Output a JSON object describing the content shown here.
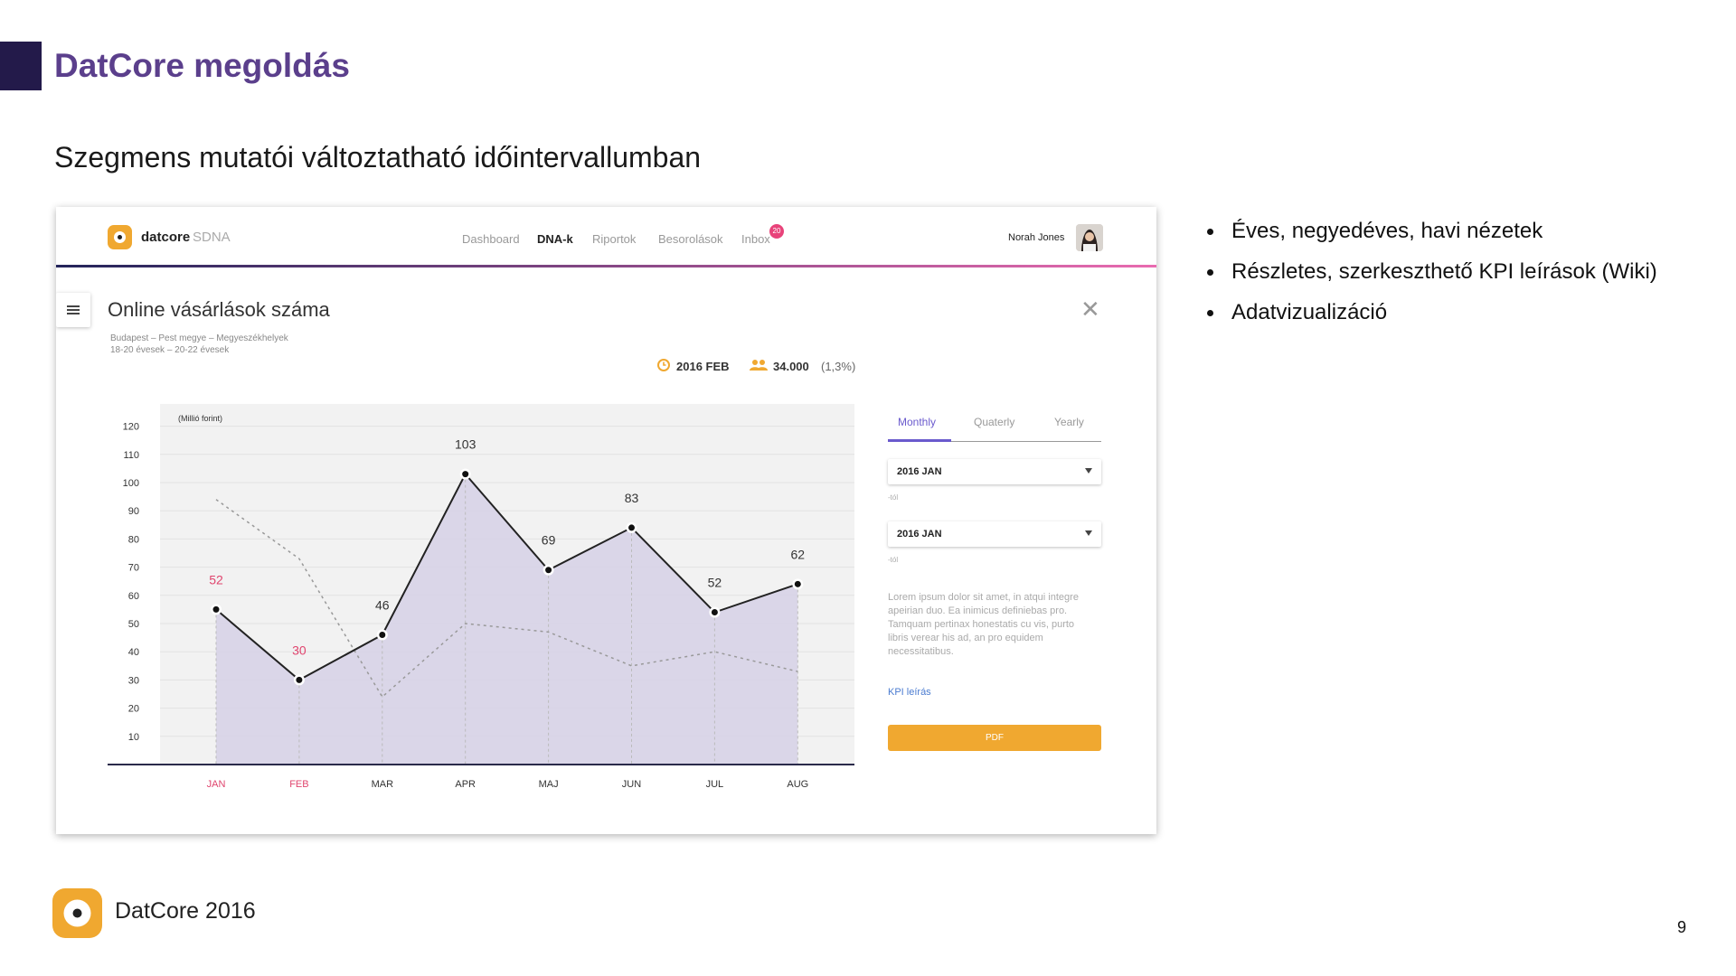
{
  "slide": {
    "title": "DatCore megoldás",
    "subtitle": "Szegmens mutatói változtatható időintervallumban",
    "bullets": [
      "Éves, negyedéves, havi nézetek",
      "Részletes, szerkeszthető KPI leírások (Wiki)",
      "Adatvizualizáció"
    ],
    "footer_text": "DatCore 2016",
    "page_number": "9",
    "colors": {
      "title": "#5b3f8c",
      "accent_block": "#231a4a",
      "logo": "#f0a830",
      "bullet": "#111111"
    }
  },
  "app": {
    "brand_name": "datcore",
    "brand_suffix": "SDNA",
    "nav": [
      "Dashboard",
      "DNA-k",
      "Riportok",
      "Besorolások",
      "Inbox"
    ],
    "nav_active": "DNA-k",
    "inbox_badge": "20",
    "user_name": "Norah Jones",
    "card_title": "Online vásárlások száma",
    "meta_lines": [
      "Budapest – Pest megye – Megyeszékhelyek",
      "18-20 évesek – 20-22 évesek"
    ],
    "stat_date": "2016 FEB",
    "stat_count": "34.000",
    "stat_percent": "(1,3%)",
    "tabs": [
      "Monthly",
      "Quaterly",
      "Yearly"
    ],
    "tab_active": "Monthly",
    "select_from": "2016 JAN",
    "select_to": "2016 JAN",
    "select_hint_from": "-tól",
    "select_hint_to": "-tól",
    "lorem_lines": [
      "Lorem ipsum dolor sit amet, in atqui integre",
      "apeirian duo. Ea inimicus definiebas pro.",
      "Tamquam pertinax honestatis cu vis, purto",
      "libris verear his ad, an pro equidem",
      "necessitatibus."
    ],
    "kpi_link": "KPI leírás",
    "pdf_button": "PDF",
    "colors": {
      "accent_orange": "#f0a830",
      "badge": "#e8437a",
      "link_blue": "#4a7bd0",
      "tab_active": "#6a5acd",
      "divider_start": "#23245a",
      "divider_end": "#e96bb0"
    }
  },
  "chart_data": {
    "type": "area",
    "ylabel": "(Millió forint)",
    "categories": [
      "JAN",
      "FEB",
      "MAR",
      "APR",
      "MAJ",
      "JUN",
      "JUL",
      "AUG"
    ],
    "highlight_categories": [
      "JAN",
      "FEB"
    ],
    "yticks": [
      10,
      20,
      30,
      40,
      50,
      60,
      70,
      80,
      90,
      100,
      110,
      120
    ],
    "ylim": [
      0,
      120
    ],
    "series": [
      {
        "values": [
          55,
          30,
          46,
          103,
          69,
          84,
          54,
          64
        ]
      },
      {
        "values": [
          94,
          73,
          24,
          50,
          47,
          35,
          40,
          33
        ]
      }
    ],
    "data_labels": [
      "52",
      "30",
      "46",
      "103",
      "69",
      "83",
      "52",
      "62"
    ],
    "grid": true,
    "colors": {
      "line": "#222222",
      "area": "#d6d1e6",
      "plot_bg": "#f2f2f2",
      "highlight": "#e0456e",
      "dashed": "#999999",
      "label": "#333333"
    }
  }
}
